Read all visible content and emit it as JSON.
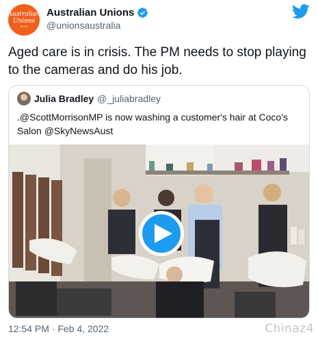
{
  "author": {
    "display_name": "Australian Unions",
    "handle": "@unionsaustralia",
    "avatar_line1": "Australian",
    "avatar_line2": "Unions",
    "avatar_line3": "ACTU",
    "avatar_color": "#f0601d",
    "verified_icon": "verified-badge-icon"
  },
  "tweet": {
    "text": "Aged care is in crisis. The PM needs to stop playing to the cameras and do his job."
  },
  "quoted_tweet": {
    "display_name": "Julia Bradley",
    "handle": "@_juliabradley",
    "text": ".@ScottMorrisonMP is now washing a customer's hair at Coco's Salon @SkyNewsAust",
    "media": {
      "type": "video",
      "play_icon": "play-icon"
    }
  },
  "meta": {
    "timestamp": "12:54 PM · Feb 4, 2022",
    "watermark": "Chinaz4"
  },
  "colors": {
    "accent": "#1d9bf0",
    "text": "#0f1419",
    "muted": "#536471",
    "border": "#cfd9de"
  }
}
